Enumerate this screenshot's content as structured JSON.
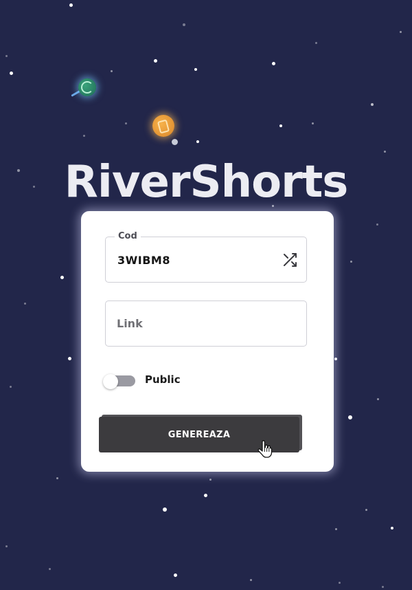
{
  "app": {
    "title": "RiverShorts"
  },
  "form": {
    "code": {
      "legend": "Cod",
      "value": "3WIBM8",
      "shuffle_icon": "shuffle-icon"
    },
    "link": {
      "placeholder": "Link",
      "value": ""
    },
    "public_toggle": {
      "label": "Public",
      "checked": false
    },
    "submit": {
      "label": "GENEREAZA"
    }
  },
  "colors": {
    "background": "#22264a",
    "card": "#ffffff",
    "button": "#3c3b3e",
    "toggle_off": "#9a9aa2",
    "title": "#ececf2"
  }
}
